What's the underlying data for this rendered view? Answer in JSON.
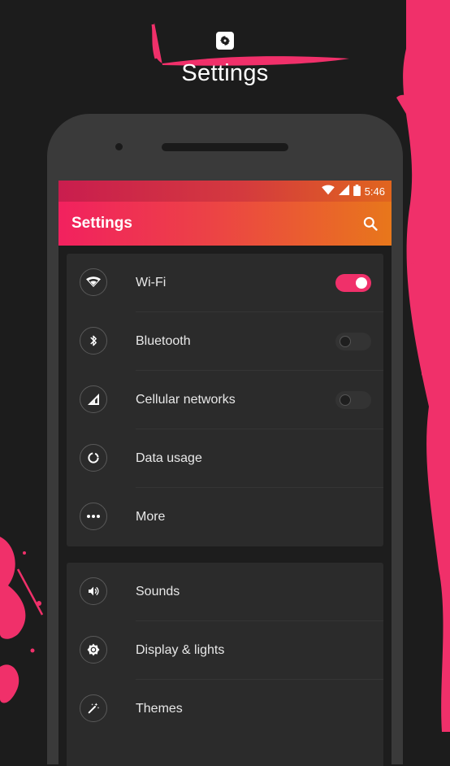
{
  "header": {
    "title": "Settings",
    "icon": "gear-icon"
  },
  "status_bar": {
    "time": "5:46",
    "icons": [
      "wifi-icon",
      "signal-icon",
      "battery-icon"
    ]
  },
  "app_bar": {
    "title": "Settings",
    "search_icon": "search-icon"
  },
  "sections": [
    {
      "items": [
        {
          "label": "Wi-Fi",
          "icon": "wifi-icon",
          "toggle": true
        },
        {
          "label": "Bluetooth",
          "icon": "bluetooth-icon",
          "toggle": false
        },
        {
          "label": "Cellular networks",
          "icon": "cellular-icon",
          "toggle": false
        },
        {
          "label": "Data usage",
          "icon": "data-usage-icon"
        },
        {
          "label": "More",
          "icon": "more-icon"
        }
      ]
    },
    {
      "items": [
        {
          "label": "Sounds",
          "icon": "volume-icon"
        },
        {
          "label": "Display & lights",
          "icon": "brightness-icon"
        },
        {
          "label": "Themes",
          "icon": "magic-wand-icon"
        }
      ]
    }
  ],
  "colors": {
    "accent": "#f0306a",
    "appbar_start": "#f2215f",
    "appbar_end": "#e8771b",
    "background": "#1c1c1c",
    "card": "#2b2b2b"
  }
}
